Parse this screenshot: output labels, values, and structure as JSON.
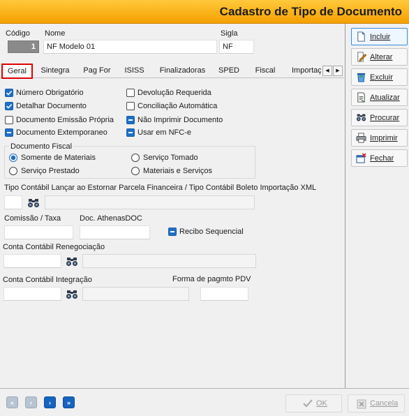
{
  "window": {
    "title": "Cadastro de Tipo de Documento"
  },
  "header": {
    "codigo_label": "Código",
    "codigo_value": "1",
    "nome_label": "Nome",
    "nome_value": "NF Modelo 01",
    "sigla_label": "Sigla",
    "sigla_value": "NF"
  },
  "tabs": [
    {
      "label": "Geral",
      "active": true
    },
    {
      "label": "Sintegra"
    },
    {
      "label": "Pag For"
    },
    {
      "label": "ISISS"
    },
    {
      "label": "Finalizadoras"
    },
    {
      "label": "SPED"
    },
    {
      "label": "Fiscal"
    },
    {
      "label": "Importaç"
    }
  ],
  "checks": {
    "numero_obrigatorio": {
      "label": "Número Obrigatório",
      "state": "checked"
    },
    "detalhar_documento": {
      "label": "Detalhar Documento",
      "state": "checked"
    },
    "documento_emissao_propria": {
      "label": "Documento Emissão Própria",
      "state": "unchecked"
    },
    "documento_extemporaneo": {
      "label": "Documento Extemporaneo",
      "state": "indeterminate"
    },
    "devolucao_requerida": {
      "label": "Devolução Requerida",
      "state": "unchecked"
    },
    "conciliacao_automatica": {
      "label": "Conciliação Automática",
      "state": "unchecked"
    },
    "nao_imprimir_documento": {
      "label": "Não Imprimir Documento",
      "state": "indeterminate"
    },
    "usar_em_nfce": {
      "label": "Usar em NFC-e",
      "state": "indeterminate"
    },
    "recibo_sequencial": {
      "label": "Recibo Sequencial",
      "state": "indeterminate"
    }
  },
  "documento_fiscal": {
    "title": "Documento Fiscal",
    "options": [
      {
        "label": "Somente de Materiais",
        "selected": true
      },
      {
        "label": "Serviço Tomado",
        "selected": false
      },
      {
        "label": "Serviço Prestado",
        "selected": false
      },
      {
        "label": "Materiais e Serviços",
        "selected": false
      }
    ]
  },
  "fields": {
    "tipo_contabil_label": "Tipo Contábil Lançar ao Estornar Parcela Financeira / Tipo Contábil Boleto Importação XML",
    "tipo_contabil_value": "",
    "comissao_label": "Comissão / Taxa",
    "comissao_value": "",
    "doc_athenas_label": "Doc. AthenasDOC",
    "doc_athenas_value": "",
    "renegociacao_label": "Conta Contábil Renegociação",
    "renegociacao_value": "",
    "integracao_label": "Conta Contábil Integração",
    "integracao_value": "",
    "forma_pagmto_label": "Forma de pagmto PDV",
    "forma_pagmto_value": ""
  },
  "sidebar": {
    "incluir": "Incluir",
    "alterar": "Alterar",
    "excluir": "Excluir",
    "atualizar": "Atualizar",
    "procurar": "Procurar",
    "imprimir": "Imprimir",
    "fechar": "Fechar"
  },
  "footer": {
    "ok": "OK",
    "cancela": "Cancela"
  },
  "colors": {
    "title_bar": "#f5a000",
    "accent": "#1e6fc8",
    "active_tab_outline": "#e00000"
  },
  "icons": [
    "binoculars-icon",
    "first-record-icon",
    "prev-record-icon",
    "next-record-icon",
    "last-record-icon"
  ]
}
